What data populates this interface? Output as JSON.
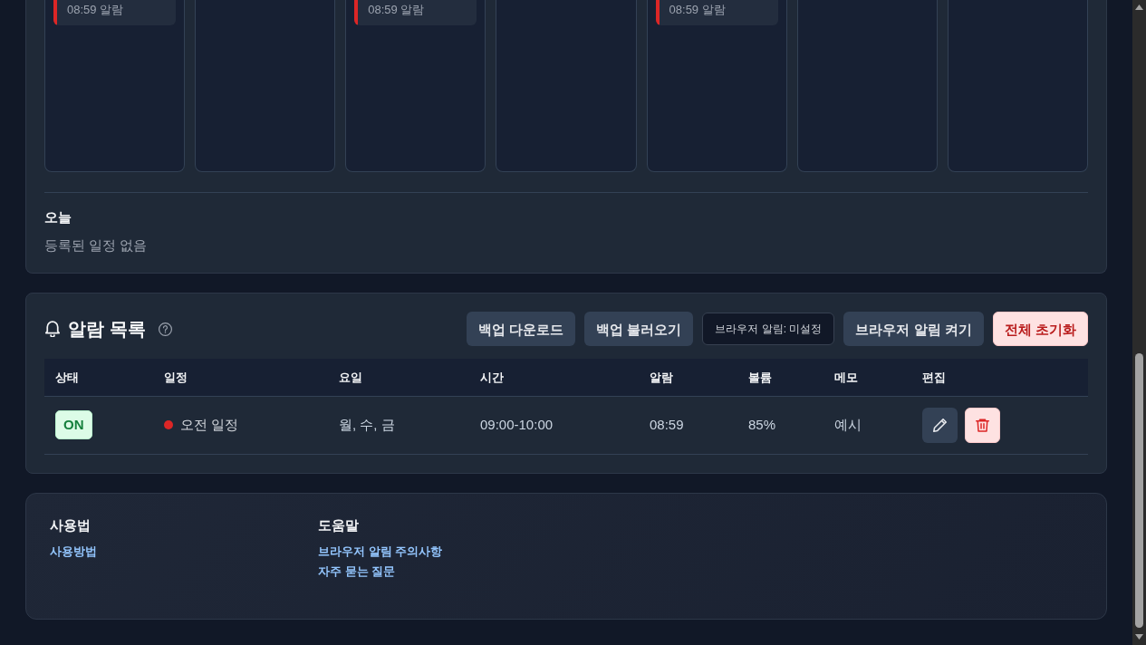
{
  "calendar": {
    "days": [
      {
        "kind": "alarm",
        "label": "08:59 알람",
        "color": "#dc2626"
      },
      {
        "kind": "empty"
      },
      {
        "kind": "alarm",
        "label": "08:59 알람",
        "color": "#dc2626"
      },
      {
        "kind": "empty"
      },
      {
        "kind": "alarm",
        "label": "08:59 알람",
        "color": "#dc2626"
      },
      {
        "kind": "empty"
      },
      {
        "kind": "empty"
      }
    ],
    "today": {
      "heading": "오늘",
      "empty_text": "등록된 일정 없음"
    }
  },
  "alarm_list": {
    "title": "알람 목록",
    "buttons": [
      {
        "label": "백업 다운로드",
        "kind": "secondary"
      },
      {
        "label": "백업 불러오기",
        "kind": "secondary"
      },
      {
        "label": "브라우저 알림: 미설정",
        "kind": "status"
      },
      {
        "label": "브라우저 알림 켜기",
        "kind": "secondary"
      },
      {
        "label": "전체 초기화",
        "kind": "danger"
      }
    ],
    "columns": [
      "상태",
      "일정",
      "요일",
      "시간",
      "알람",
      "볼륨",
      "메모",
      "편집"
    ],
    "rows": [
      {
        "on": true,
        "status_label": "ON",
        "schedule": "오전 일정",
        "color": "#dc2626",
        "days": "월, 수, 금",
        "time": "09:00-10:00",
        "alarm": "08:59",
        "volume": "85%",
        "memo": "예시"
      }
    ]
  },
  "footer": {
    "sections": [
      {
        "heading": "사용법",
        "links": [
          "사용방법"
        ]
      },
      {
        "heading": "도움말",
        "links": [
          "브라우저 알림 주의사항",
          "자주 묻는 질문"
        ]
      }
    ]
  }
}
